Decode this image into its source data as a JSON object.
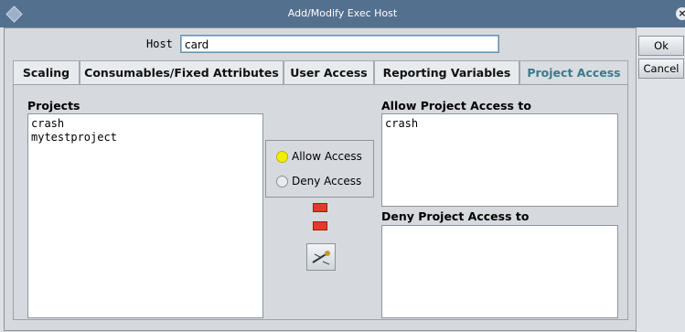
{
  "window": {
    "title": "Add/Modify Exec Host",
    "close_glyph": "×"
  },
  "host": {
    "label": "Host",
    "value": "card"
  },
  "buttons": {
    "ok": "Ok",
    "cancel": "Cancel"
  },
  "tabs": [
    {
      "label": "Scaling"
    },
    {
      "label": "Consumables/Fixed Attributes"
    },
    {
      "label": "User Access"
    },
    {
      "label": "Reporting Variables"
    },
    {
      "label": "Project Access",
      "active": true
    }
  ],
  "projects": {
    "label": "Projects",
    "items": [
      "crash",
      "mytestproject"
    ]
  },
  "access": {
    "allow_label": "Allow Access",
    "deny_label": "Deny Access",
    "selected": "Allow Access"
  },
  "allow_list": {
    "label": "Allow Project Access to",
    "items": [
      "crash"
    ]
  },
  "deny_list": {
    "label": "Deny Project Access to",
    "items": []
  },
  "icons": [
    "window-menu-icon",
    "close-icon",
    "add-arrow-icon",
    "remove-arrow-icon",
    "tool-icon"
  ],
  "colors": {
    "titlebar": "#54708f",
    "active_tab_text": "#3a7a8a",
    "radio_selected": "#f2f000",
    "arrow": "#e23b28"
  }
}
